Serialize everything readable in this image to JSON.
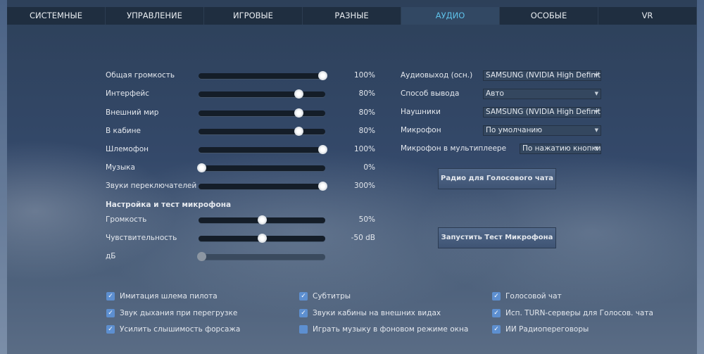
{
  "tabs": [
    "СИСТЕМНЫЕ",
    "УПРАВЛЕНИЕ",
    "ИГРОВЫЕ",
    "РАЗНЫЕ",
    "АУДИО",
    "ОСОБЫЕ",
    "VR"
  ],
  "active_tab": "АУДИО",
  "sliders": [
    {
      "label": "Общая громкость",
      "value": "100%",
      "fraction": 1.0
    },
    {
      "label": "Интерфейс",
      "value": "80%",
      "fraction": 0.8
    },
    {
      "label": "Внешний мир",
      "value": "80%",
      "fraction": 0.8
    },
    {
      "label": "В кабине",
      "value": "80%",
      "fraction": 0.8
    },
    {
      "label": "Шлемофон",
      "value": "100%",
      "fraction": 1.0
    },
    {
      "label": "Музыка",
      "value": "0%",
      "fraction": 0.0
    },
    {
      "label": "Звуки переключателей",
      "value": "300%",
      "fraction": 1.0
    }
  ],
  "mic_section": {
    "title": "Настройка и тест микрофона",
    "sliders": [
      {
        "label": "Громкость",
        "value": "50%",
        "fraction": 0.5
      },
      {
        "label": "Чувствительность",
        "value": "-50 dB",
        "fraction": 0.5
      },
      {
        "label": "дБ",
        "value": "",
        "fraction": 0.0
      }
    ]
  },
  "selects": [
    {
      "label": "Аудиовыход (осн.)",
      "value": "SAMSUNG (NVIDIA High Definition"
    },
    {
      "label": "Способ вывода",
      "value": "Авто"
    },
    {
      "label": "Наушники",
      "value": "SAMSUNG (NVIDIA High Definition"
    },
    {
      "label": "Микрофон",
      "value": "По умолчанию"
    },
    {
      "label": "Микрофон в мультиплеере",
      "value": "По нажатию кнопки"
    }
  ],
  "buttons": {
    "radio": "Радио для Голосового чата",
    "mic_test": "Запустить Тест Микрофона"
  },
  "checkboxes": [
    {
      "label": "Имитация шлема пилота",
      "checked": true
    },
    {
      "label": "Звук дыхания при перегрузке",
      "checked": true
    },
    {
      "label": "Усилить слышимость форсажа",
      "checked": true
    },
    {
      "label": "Субтитры",
      "checked": true
    },
    {
      "label": "Звуки кабины на внешних видах",
      "checked": true
    },
    {
      "label": "Играть музыку в фоновом режиме окна",
      "checked": false
    },
    {
      "label": "Голосовой чат",
      "checked": true
    },
    {
      "label": "Исп. TURN-серверы для Голосов. чата",
      "checked": true
    },
    {
      "label": "ИИ Радиопереговоры",
      "checked": true
    }
  ]
}
